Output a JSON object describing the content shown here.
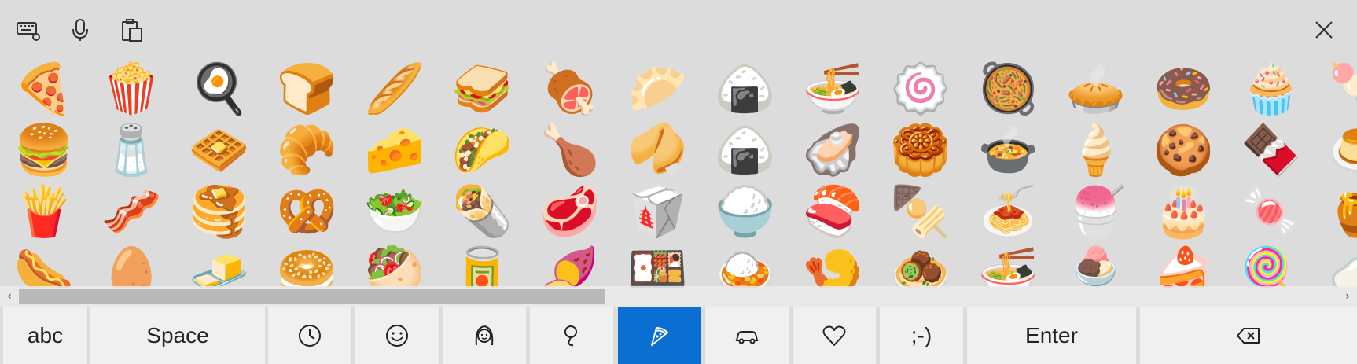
{
  "topbar": {
    "icons": [
      "keyboard-settings-icon",
      "microphone-icon",
      "clipboard-icon"
    ],
    "close_icon": "close-icon"
  },
  "emoji_grid": [
    [
      "🍕",
      "🍿",
      "🍳",
      "🍞",
      "🥖",
      "🥪",
      "🍖",
      "🥟",
      "🍙",
      "🍜",
      "🍥",
      "🥘",
      "🥧",
      "🍩",
      "🧁",
      "🍡"
    ],
    [
      "🍔",
      "🧂",
      "🧇",
      "🥐",
      "🧀",
      "🌮",
      "🍗",
      "🥠",
      "🍙",
      "🦪",
      "🥮",
      "🍲",
      "🍦",
      "🍪",
      "🍫",
      "🍮"
    ],
    [
      "🍟",
      "🥓",
      "🥞",
      "🥨",
      "🥗",
      "🌯",
      "🥩",
      "🥡",
      "🍚",
      "🍣",
      "🍢",
      "🍝",
      "🍧",
      "🎂",
      "🍬",
      "🍯"
    ],
    [
      "🌭",
      "🥚",
      "🧈",
      "🥯",
      "🥙",
      "🥫",
      "🍠",
      "🍱",
      "🍛",
      "🍤",
      "🧆",
      "🍜",
      "🍨",
      "🍰",
      "🍭",
      "🍼"
    ]
  ],
  "scrollbar": {
    "left_arrow": "‹",
    "right_arrow": "›"
  },
  "keys": {
    "abc": "abc",
    "space": "Space",
    "enter": "Enter"
  },
  "categories": [
    "recent-icon",
    "smiley-icon",
    "people-icon",
    "celebration-icon",
    "food-icon",
    "travel-icon",
    "heart-icon",
    ";-)"
  ],
  "active_category": "food",
  "colors": {
    "accent": "#0a6fd1",
    "key_bg": "#f0f0f0",
    "panel_bg": "#dcdcdc"
  }
}
